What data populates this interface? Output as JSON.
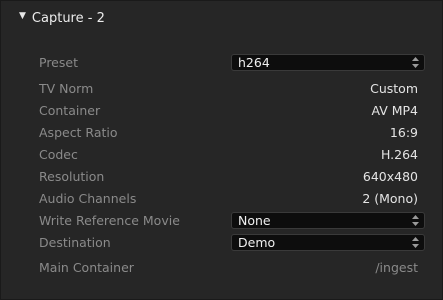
{
  "section": {
    "title": "Capture - 2"
  },
  "rows": {
    "preset": {
      "label": "Preset",
      "value": "h264"
    },
    "tv_norm": {
      "label": "TV Norm",
      "value": "Custom"
    },
    "container": {
      "label": "Container",
      "value": "AV MP4"
    },
    "aspect_ratio": {
      "label": "Aspect Ratio",
      "value": "16:9"
    },
    "codec": {
      "label": "Codec",
      "value": "H.264"
    },
    "resolution": {
      "label": "Resolution",
      "value": "640x480"
    },
    "audio_channels": {
      "label": "Audio Channels",
      "value": "2 (Mono)"
    },
    "write_reference_movie": {
      "label": "Write Reference Movie",
      "value": "None"
    },
    "destination": {
      "label": "Destination",
      "value": "Demo"
    },
    "main_container": {
      "label": "Main Container",
      "value": "/ingest"
    }
  },
  "colors": {
    "panel_bg": "#262626",
    "label": "#8a8a8a",
    "value": "#e4e4e4",
    "select_bg": "#0d0d0d"
  }
}
